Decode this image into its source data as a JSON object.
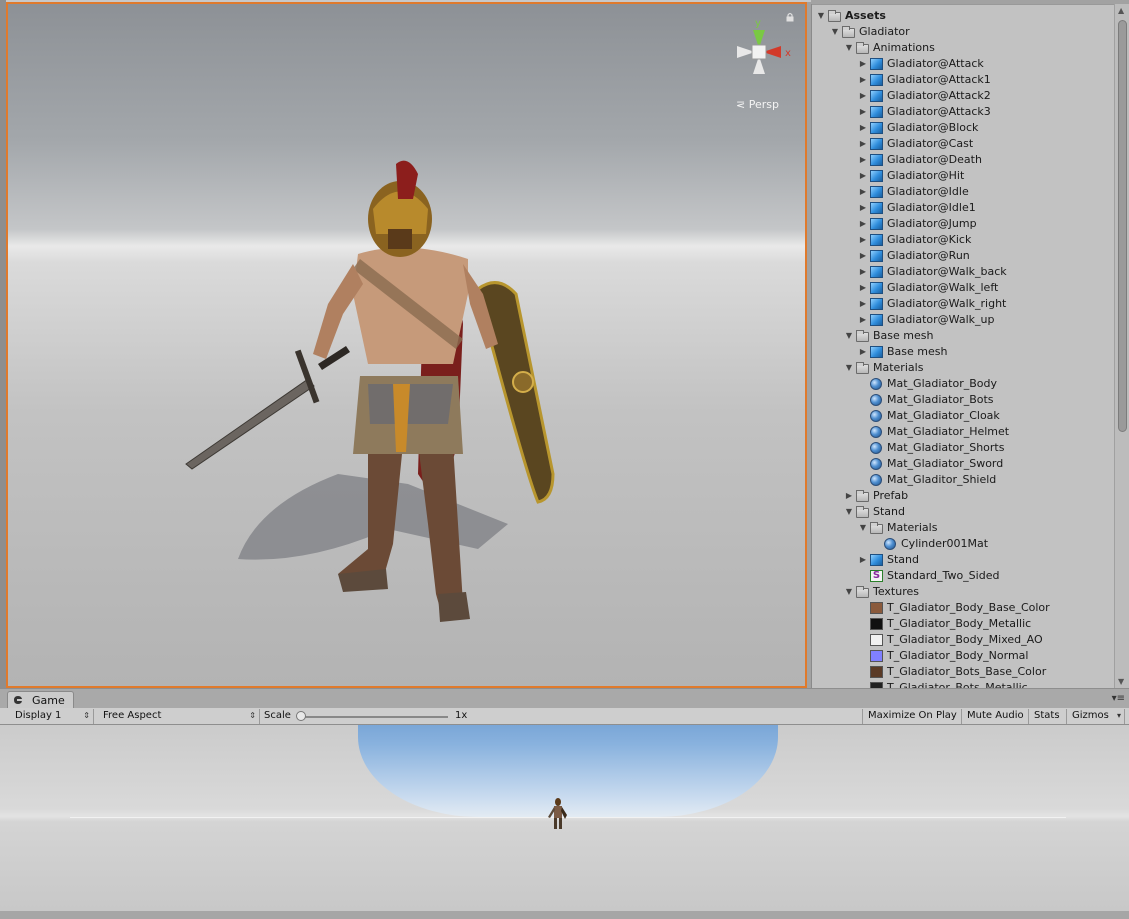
{
  "scene": {
    "persp_label": "Persp",
    "gizmo_axes": {
      "y": "y",
      "x": "x"
    }
  },
  "project": {
    "tree": [
      {
        "label": "Assets",
        "depth": 0,
        "kind": "folder",
        "expand": "down",
        "bold": true
      },
      {
        "label": "Gladiator",
        "depth": 1,
        "kind": "folder",
        "expand": "down"
      },
      {
        "label": "Animations",
        "depth": 2,
        "kind": "folder",
        "expand": "down"
      },
      {
        "label": "Gladiator@Attack",
        "depth": 3,
        "kind": "mesh",
        "expand": "right"
      },
      {
        "label": "Gladiator@Attack1",
        "depth": 3,
        "kind": "mesh",
        "expand": "right"
      },
      {
        "label": "Gladiator@Attack2",
        "depth": 3,
        "kind": "mesh",
        "expand": "right"
      },
      {
        "label": "Gladiator@Attack3",
        "depth": 3,
        "kind": "mesh",
        "expand": "right"
      },
      {
        "label": "Gladiator@Block",
        "depth": 3,
        "kind": "mesh",
        "expand": "right"
      },
      {
        "label": "Gladiator@Cast",
        "depth": 3,
        "kind": "mesh",
        "expand": "right"
      },
      {
        "label": "Gladiator@Death",
        "depth": 3,
        "kind": "mesh",
        "expand": "right"
      },
      {
        "label": "Gladiator@Hit",
        "depth": 3,
        "kind": "mesh",
        "expand": "right"
      },
      {
        "label": "Gladiator@Idle",
        "depth": 3,
        "kind": "mesh",
        "expand": "right"
      },
      {
        "label": "Gladiator@Idle1",
        "depth": 3,
        "kind": "mesh",
        "expand": "right"
      },
      {
        "label": "Gladiator@Jump",
        "depth": 3,
        "kind": "mesh",
        "expand": "right"
      },
      {
        "label": "Gladiator@Kick",
        "depth": 3,
        "kind": "mesh",
        "expand": "right"
      },
      {
        "label": "Gladiator@Run",
        "depth": 3,
        "kind": "mesh",
        "expand": "right"
      },
      {
        "label": "Gladiator@Walk_back",
        "depth": 3,
        "kind": "mesh",
        "expand": "right"
      },
      {
        "label": "Gladiator@Walk_left",
        "depth": 3,
        "kind": "mesh",
        "expand": "right"
      },
      {
        "label": "Gladiator@Walk_right",
        "depth": 3,
        "kind": "mesh",
        "expand": "right"
      },
      {
        "label": "Gladiator@Walk_up",
        "depth": 3,
        "kind": "mesh",
        "expand": "right"
      },
      {
        "label": "Base mesh",
        "depth": 2,
        "kind": "folder",
        "expand": "down"
      },
      {
        "label": "Base mesh",
        "depth": 3,
        "kind": "mesh",
        "expand": "right"
      },
      {
        "label": "Materials",
        "depth": 2,
        "kind": "folder",
        "expand": "down"
      },
      {
        "label": "Mat_Gladiator_Body",
        "depth": 3,
        "kind": "material",
        "expand": ""
      },
      {
        "label": "Mat_Gladiator_Bots",
        "depth": 3,
        "kind": "material",
        "expand": ""
      },
      {
        "label": "Mat_Gladiator_Cloak",
        "depth": 3,
        "kind": "material",
        "expand": ""
      },
      {
        "label": "Mat_Gladiator_Helmet",
        "depth": 3,
        "kind": "material",
        "expand": ""
      },
      {
        "label": "Mat_Gladiator_Shorts",
        "depth": 3,
        "kind": "material",
        "expand": ""
      },
      {
        "label": "Mat_Gladiator_Sword",
        "depth": 3,
        "kind": "material",
        "expand": ""
      },
      {
        "label": "Mat_Gladitor_Shield",
        "depth": 3,
        "kind": "material",
        "expand": ""
      },
      {
        "label": "Prefab",
        "depth": 2,
        "kind": "folder",
        "expand": "right"
      },
      {
        "label": "Stand",
        "depth": 2,
        "kind": "folder",
        "expand": "down"
      },
      {
        "label": "Materials",
        "depth": 3,
        "kind": "folder",
        "expand": "down"
      },
      {
        "label": "Cylinder001Mat",
        "depth": 4,
        "kind": "material",
        "expand": ""
      },
      {
        "label": "Stand",
        "depth": 3,
        "kind": "mesh",
        "expand": "right"
      },
      {
        "label": "Standard_Two_Sided",
        "depth": 3,
        "kind": "shader",
        "expand": ""
      },
      {
        "label": "Textures",
        "depth": 2,
        "kind": "folder",
        "expand": "down"
      },
      {
        "label": "T_Gladiator_Body_Base_Color",
        "depth": 3,
        "kind": "texture",
        "swatch": "#8a5a3c",
        "expand": ""
      },
      {
        "label": "T_Gladiator_Body_Metallic",
        "depth": 3,
        "kind": "texture",
        "swatch": "#111111",
        "expand": ""
      },
      {
        "label": "T_Gladiator_Body_Mixed_AO",
        "depth": 3,
        "kind": "texture",
        "swatch": "#f0f0f0",
        "expand": ""
      },
      {
        "label": "T_Gladiator_Body_Normal",
        "depth": 3,
        "kind": "texture",
        "swatch": "#8080ff",
        "expand": ""
      },
      {
        "label": "T_Gladiator_Bots_Base_Color",
        "depth": 3,
        "kind": "texture",
        "swatch": "#5a3a26",
        "expand": ""
      },
      {
        "label": "T_Gladiator_Bots_Metallic",
        "depth": 3,
        "kind": "texture",
        "swatch": "#222222",
        "expand": ""
      }
    ]
  },
  "game": {
    "tab_label": "Game",
    "toolbar": {
      "display": "Display 1",
      "aspect": "Free Aspect",
      "scale_label": "Scale",
      "scale_value": "1x",
      "maximize": "Maximize On Play",
      "mute": "Mute Audio",
      "stats": "Stats",
      "gizmos": "Gizmos"
    }
  },
  "colors": {
    "scene_border": "#e07a2c",
    "panel_bg": "#c2c2c2",
    "sky": "#5b8ec9"
  }
}
